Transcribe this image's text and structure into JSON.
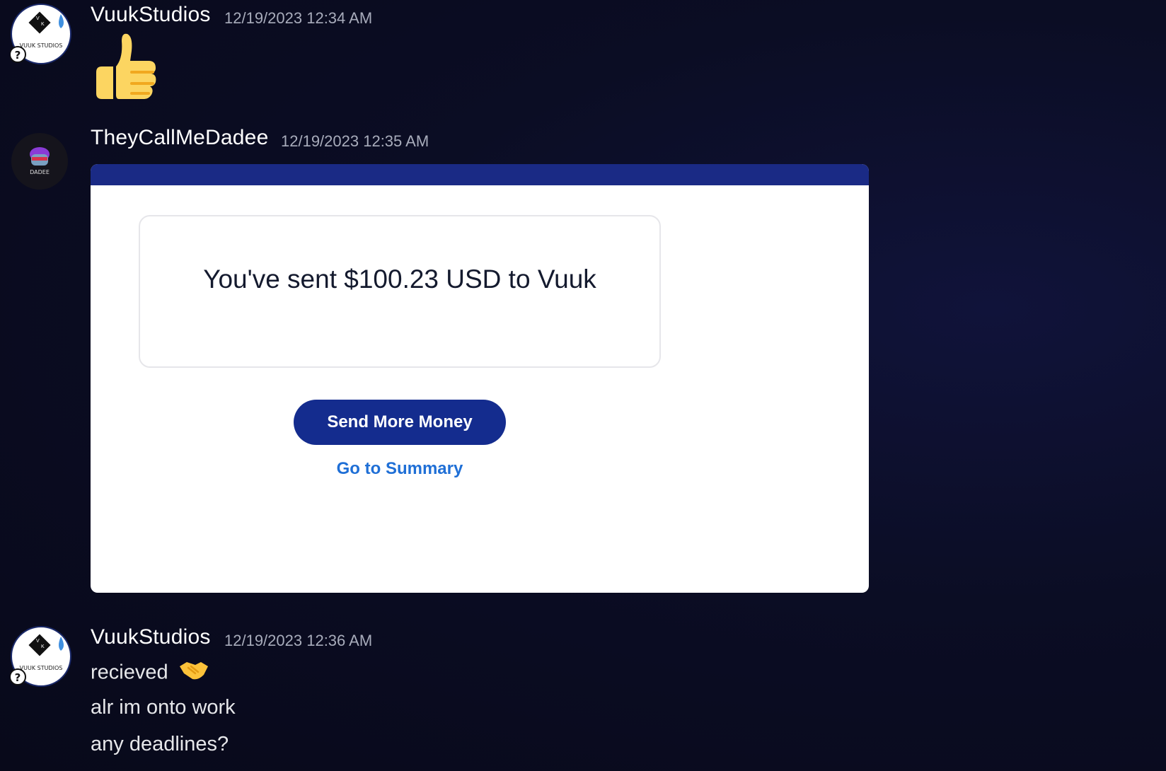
{
  "messages": [
    {
      "author": "VuukStudios",
      "timestamp": "12/19/2023 12:34 AM",
      "avatar_text": "VUUK STUDIOS",
      "content_emoji": "thumbs-up"
    },
    {
      "author": "TheyCallMeDadee",
      "timestamp": "12/19/2023 12:35 AM",
      "avatar_text": "DADEE",
      "attachment": {
        "sent_text": "You've sent $100.23 USD to Vuuk",
        "primary_button": "Send More Money",
        "link": "Go to Summary"
      }
    },
    {
      "author": "VuukStudios",
      "timestamp": "12/19/2023 12:36 AM",
      "avatar_text": "VUUK STUDIOS",
      "lines": [
        "recieved",
        "alr im onto work",
        "any deadlines?"
      ],
      "first_line_emoji": "handshake"
    }
  ],
  "colors": {
    "background": "#0b0d24",
    "attachment_header": "#1a2a85",
    "button": "#142c8e",
    "link": "#1f6fd6"
  }
}
